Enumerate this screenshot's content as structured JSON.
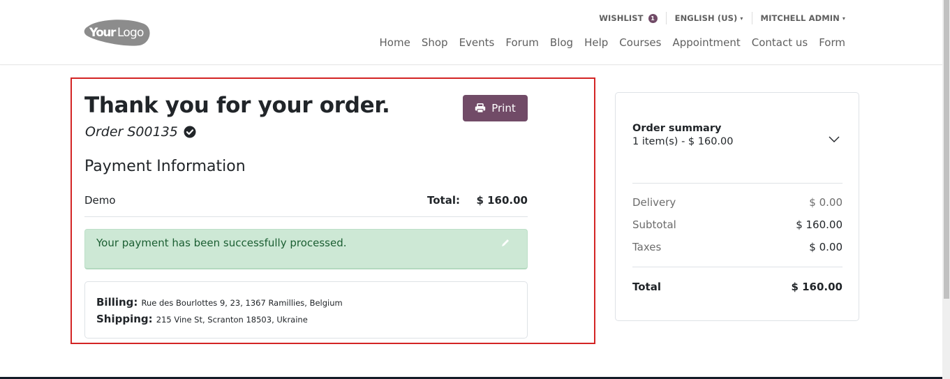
{
  "header": {
    "logo_text_bold": "Your",
    "logo_text_light": "Logo",
    "top_links": {
      "wishlist_label": "WISHLIST",
      "wishlist_count": "1",
      "language_label": "ENGLISH (US)",
      "user_label": "MITCHELL ADMIN"
    },
    "nav": [
      {
        "label": "Home"
      },
      {
        "label": "Shop"
      },
      {
        "label": "Events"
      },
      {
        "label": "Forum"
      },
      {
        "label": "Blog"
      },
      {
        "label": "Help"
      },
      {
        "label": "Courses"
      },
      {
        "label": "Appointment"
      },
      {
        "label": "Contact us"
      },
      {
        "label": "Form"
      }
    ]
  },
  "confirmation": {
    "title": "Thank you for your order.",
    "order_ref": "Order S00135",
    "print_label": "Print",
    "payment_section_title": "Payment Information",
    "payment_method": "Demo",
    "total_label": "Total:",
    "total_value": "$ 160.00",
    "alert_message": "Your payment has been successfully processed.",
    "billing_label": "Billing:",
    "billing_address": "Rue des Bourlottes 9, 23, 1367 Ramillies, Belgium",
    "shipping_label": "Shipping:",
    "shipping_address": "215 Vine St, Scranton 18503, Ukraine"
  },
  "summary": {
    "title": "Order summary",
    "subtitle": "1 item(s) -  $ 160.00",
    "rows": [
      {
        "label": "Delivery",
        "value": "$ 0.00"
      },
      {
        "label": "Subtotal",
        "value": "$ 160.00"
      },
      {
        "label": "Taxes",
        "value": "$ 0.00"
      }
    ],
    "total_label": "Total",
    "total_value": "$ 160.00"
  },
  "colors": {
    "brand": "#714b67",
    "alert_bg": "#cde8d5",
    "alert_text": "#1b5e32",
    "highlight": "#d32424"
  }
}
